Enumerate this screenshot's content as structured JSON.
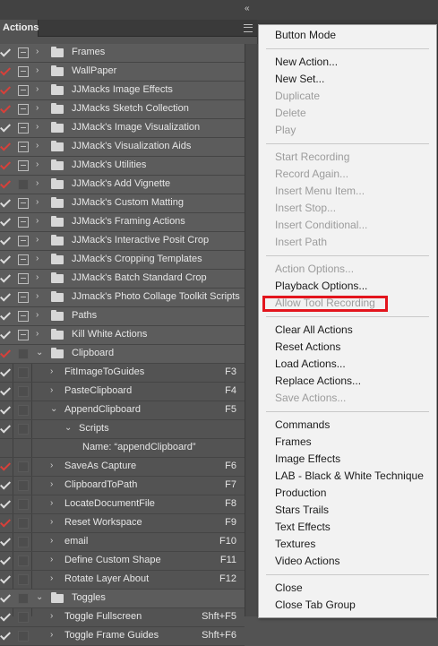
{
  "panel": {
    "tab_label": "Actions",
    "collapse_glyph": "«",
    "menu_icon": "hamburger-icon"
  },
  "rows": [
    {
      "label": "Frames",
      "check": "white",
      "dialog": true,
      "kind": "set",
      "expand": "collapsed",
      "indent": 0,
      "fkey": ""
    },
    {
      "label": "WallPaper",
      "check": "red",
      "dialog": true,
      "kind": "set",
      "expand": "collapsed",
      "indent": 0,
      "fkey": ""
    },
    {
      "label": "JJMacks Image Effects",
      "check": "red",
      "dialog": true,
      "kind": "set",
      "expand": "collapsed",
      "indent": 0,
      "fkey": ""
    },
    {
      "label": "JJMacks Sketch Collection",
      "check": "red",
      "dialog": true,
      "kind": "set",
      "expand": "collapsed",
      "indent": 0,
      "fkey": ""
    },
    {
      "label": "JJMack's Image Visualization",
      "check": "white",
      "dialog": true,
      "kind": "set",
      "expand": "collapsed",
      "indent": 0,
      "fkey": ""
    },
    {
      "label": "JJMack's Visualization Aids",
      "check": "red",
      "dialog": true,
      "kind": "set",
      "expand": "collapsed",
      "indent": 0,
      "fkey": ""
    },
    {
      "label": "JJMack's Utilities",
      "check": "red",
      "dialog": true,
      "kind": "set",
      "expand": "collapsed",
      "indent": 0,
      "fkey": ""
    },
    {
      "label": "JJMack's Add Vignette",
      "check": "red",
      "dialog": false,
      "kind": "set",
      "expand": "collapsed",
      "indent": 0,
      "fkey": ""
    },
    {
      "label": "JJMack's Custom Matting",
      "check": "white",
      "dialog": true,
      "kind": "set",
      "expand": "collapsed",
      "indent": 0,
      "fkey": ""
    },
    {
      "label": "JJMack's Framing Actions",
      "check": "white",
      "dialog": true,
      "kind": "set",
      "expand": "collapsed",
      "indent": 0,
      "fkey": ""
    },
    {
      "label": "JJMack's Interactive Posit Crop",
      "check": "white",
      "dialog": true,
      "kind": "set",
      "expand": "collapsed",
      "indent": 0,
      "fkey": ""
    },
    {
      "label": "JJMack's Cropping Templates",
      "check": "white",
      "dialog": true,
      "kind": "set",
      "expand": "collapsed",
      "indent": 0,
      "fkey": ""
    },
    {
      "label": "JJMack's Batch Standard Crop",
      "check": "white",
      "dialog": true,
      "kind": "set",
      "expand": "collapsed",
      "indent": 0,
      "fkey": ""
    },
    {
      "label": "JJmack's Photo Collage Toolkit Scripts",
      "check": "white",
      "dialog": true,
      "kind": "set",
      "expand": "collapsed",
      "indent": 0,
      "fkey": ""
    },
    {
      "label": "Paths",
      "check": "white",
      "dialog": true,
      "kind": "set",
      "expand": "collapsed",
      "indent": 0,
      "fkey": ""
    },
    {
      "label": "Kill White Actions",
      "check": "white",
      "dialog": true,
      "kind": "set",
      "expand": "collapsed",
      "indent": 0,
      "fkey": ""
    },
    {
      "label": "Clipboard",
      "check": "red",
      "dialog": false,
      "kind": "set",
      "expand": "expanded",
      "indent": 0,
      "fkey": ""
    },
    {
      "label": "FitImageToGuides",
      "check": "white",
      "dialog": false,
      "kind": "action",
      "expand": "collapsed",
      "indent": 1,
      "fkey": "F3"
    },
    {
      "label": "PasteClipboard",
      "check": "white",
      "dialog": false,
      "kind": "action",
      "expand": "collapsed",
      "indent": 1,
      "fkey": "F4"
    },
    {
      "label": "AppendClipboard",
      "check": "white",
      "dialog": false,
      "kind": "action",
      "expand": "expanded",
      "indent": 1,
      "fkey": "F5"
    },
    {
      "label": "Scripts",
      "check": "white",
      "dialog": false,
      "kind": "step",
      "expand": "expanded",
      "indent": 2,
      "fkey": ""
    },
    {
      "label": "Name:  “appendClipboard”",
      "check": "none",
      "dialog": false,
      "kind": "detail",
      "expand": "none",
      "indent": 3,
      "fkey": ""
    },
    {
      "label": "SaveAs Capture",
      "check": "red",
      "dialog": false,
      "kind": "action",
      "expand": "collapsed",
      "indent": 1,
      "fkey": "F6"
    },
    {
      "label": "ClipboardToPath",
      "check": "white",
      "dialog": false,
      "kind": "action",
      "expand": "collapsed",
      "indent": 1,
      "fkey": "F7"
    },
    {
      "label": "LocateDocumentFile",
      "check": "white",
      "dialog": false,
      "kind": "action",
      "expand": "collapsed",
      "indent": 1,
      "fkey": "F8"
    },
    {
      "label": "Reset Workspace",
      "check": "red",
      "dialog": false,
      "kind": "action",
      "expand": "collapsed",
      "indent": 1,
      "fkey": "F9"
    },
    {
      "label": "email",
      "check": "white",
      "dialog": false,
      "kind": "action",
      "expand": "collapsed",
      "indent": 1,
      "fkey": "F10"
    },
    {
      "label": "Define Custom Shape",
      "check": "white",
      "dialog": false,
      "kind": "action",
      "expand": "collapsed",
      "indent": 1,
      "fkey": "F11"
    },
    {
      "label": "Rotate Layer About",
      "check": "white",
      "dialog": false,
      "kind": "action",
      "expand": "collapsed",
      "indent": 1,
      "fkey": "F12"
    },
    {
      "label": "Toggles",
      "check": "white",
      "dialog": false,
      "kind": "set",
      "expand": "expanded",
      "indent": 0,
      "fkey": ""
    },
    {
      "label": "Toggle Fullscreen",
      "check": "white",
      "dialog": false,
      "kind": "action",
      "expand": "collapsed",
      "indent": 1,
      "fkey": "Shft+F5"
    },
    {
      "label": "Toggle Frame Guides",
      "check": "white",
      "dialog": false,
      "kind": "action",
      "expand": "collapsed",
      "indent": 1,
      "fkey": "Shft+F6"
    }
  ],
  "menu": [
    {
      "label": "Button Mode",
      "enabled": true
    },
    {
      "sep": true
    },
    {
      "label": "New Action...",
      "enabled": true
    },
    {
      "label": "New Set...",
      "enabled": true
    },
    {
      "label": "Duplicate",
      "enabled": false
    },
    {
      "label": "Delete",
      "enabled": false
    },
    {
      "label": "Play",
      "enabled": false
    },
    {
      "sep": true
    },
    {
      "label": "Start Recording",
      "enabled": false
    },
    {
      "label": "Record Again...",
      "enabled": false
    },
    {
      "label": "Insert Menu Item...",
      "enabled": false
    },
    {
      "label": "Insert Stop...",
      "enabled": false
    },
    {
      "label": "Insert Conditional...",
      "enabled": false
    },
    {
      "label": "Insert Path",
      "enabled": false
    },
    {
      "sep": true
    },
    {
      "label": "Action Options...",
      "enabled": false
    },
    {
      "label": "Playback Options...",
      "enabled": true
    },
    {
      "label": "Allow Tool Recording",
      "enabled": false,
      "highlighted": true
    },
    {
      "sep": true
    },
    {
      "label": "Clear All Actions",
      "enabled": true
    },
    {
      "label": "Reset Actions",
      "enabled": true
    },
    {
      "label": "Load Actions...",
      "enabled": true
    },
    {
      "label": "Replace Actions...",
      "enabled": true
    },
    {
      "label": "Save Actions...",
      "enabled": false
    },
    {
      "sep": true
    },
    {
      "label": "Commands",
      "enabled": true
    },
    {
      "label": "Frames",
      "enabled": true
    },
    {
      "label": "Image Effects",
      "enabled": true
    },
    {
      "label": "LAB - Black & White Technique",
      "enabled": true
    },
    {
      "label": "Production",
      "enabled": true
    },
    {
      "label": "Stars Trails",
      "enabled": true
    },
    {
      "label": "Text Effects",
      "enabled": true
    },
    {
      "label": "Textures",
      "enabled": true
    },
    {
      "label": "Video Actions",
      "enabled": true
    },
    {
      "sep": true
    },
    {
      "label": "Close",
      "enabled": true
    },
    {
      "label": "Close Tab Group",
      "enabled": true
    }
  ],
  "colors": {
    "check_red": "#d8403a",
    "check_white": "#dcdcdc",
    "highlight_box": "#e3151d",
    "menu_bg": "#f2f2f2",
    "panel_bg": "#535353"
  }
}
